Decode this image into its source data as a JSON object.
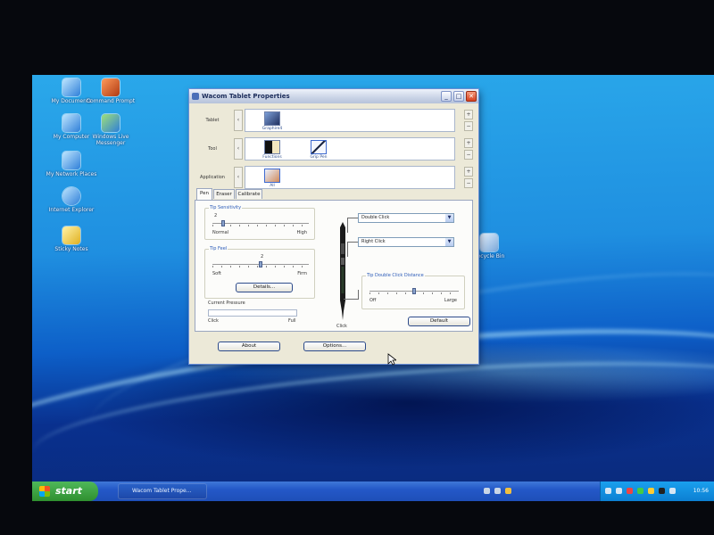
{
  "desktop": {
    "icons": [
      {
        "label": "My Documents",
        "icon": "my-documents-icon"
      },
      {
        "label": "Command Prompt",
        "icon": "command-prompt-icon"
      },
      {
        "label": "My Computer",
        "icon": "my-computer-icon"
      },
      {
        "label": "Windows Live Messenger",
        "icon": "messenger-icon"
      },
      {
        "label": "My Network Places",
        "icon": "network-places-icon"
      },
      {
        "label": "Internet Explorer",
        "icon": "internet-explorer-icon"
      },
      {
        "label": "Sticky Notes",
        "icon": "sticky-notes-icon"
      },
      {
        "label": "Recycle Bin",
        "icon": "recycle-bin-icon"
      }
    ]
  },
  "window": {
    "title": "Wacom Tablet Properties",
    "controls": {
      "minimize": "_",
      "maximize": "□",
      "close": "✕"
    },
    "rows": {
      "tablet": {
        "label": "Tablet",
        "items": [
          {
            "label": "Graphire4",
            "icon": "tablet-icon"
          }
        ]
      },
      "tool": {
        "label": "Tool",
        "items": [
          {
            "label": "Functions",
            "icon": "functions-icon"
          },
          {
            "label": "Grip Pen",
            "icon": "grip-pen-icon"
          }
        ]
      },
      "application": {
        "label": "Application",
        "items": [
          {
            "label": "All",
            "icon": "all-applications-icon"
          }
        ]
      }
    },
    "row_buttons": {
      "add": "+",
      "remove": "−",
      "scroll_left": "‹"
    },
    "tabs": [
      "Pen",
      "Eraser",
      "Calibrate"
    ],
    "active_tab": "Pen",
    "pen_tab": {
      "tip_sensitivity": {
        "label": "Tip Sensitivity",
        "value": "2",
        "min_label": "Normal",
        "max_label": "High",
        "position": 0.1
      },
      "tip_feel": {
        "label": "Tip Feel",
        "value": "2",
        "min_label": "Soft",
        "max_label": "Firm",
        "position": 0.5,
        "details_button": "Details..."
      },
      "current_pressure": {
        "label": "Current Pressure",
        "min_label": "Click",
        "max_label": "Full",
        "level": 0
      },
      "upper_button": "Double Click",
      "lower_button": "Right Click",
      "tip_label": "Click",
      "tip_double_click_distance": {
        "label": "Tip Double Click Distance",
        "min_label": "Off",
        "max_label": "Large",
        "position": 0.5
      },
      "default_button": "Default"
    },
    "footer": {
      "about_button": "About",
      "options_button": "Options..."
    }
  },
  "taskbar": {
    "start_label": "start",
    "task_button": "Wacom Tablet Prope...",
    "clock": "10:56"
  },
  "colors": {
    "accent": "#2b5bb8",
    "taskbar": "#2458c8",
    "start": "#2f8f2f",
    "tray": "#0c7fd2"
  }
}
